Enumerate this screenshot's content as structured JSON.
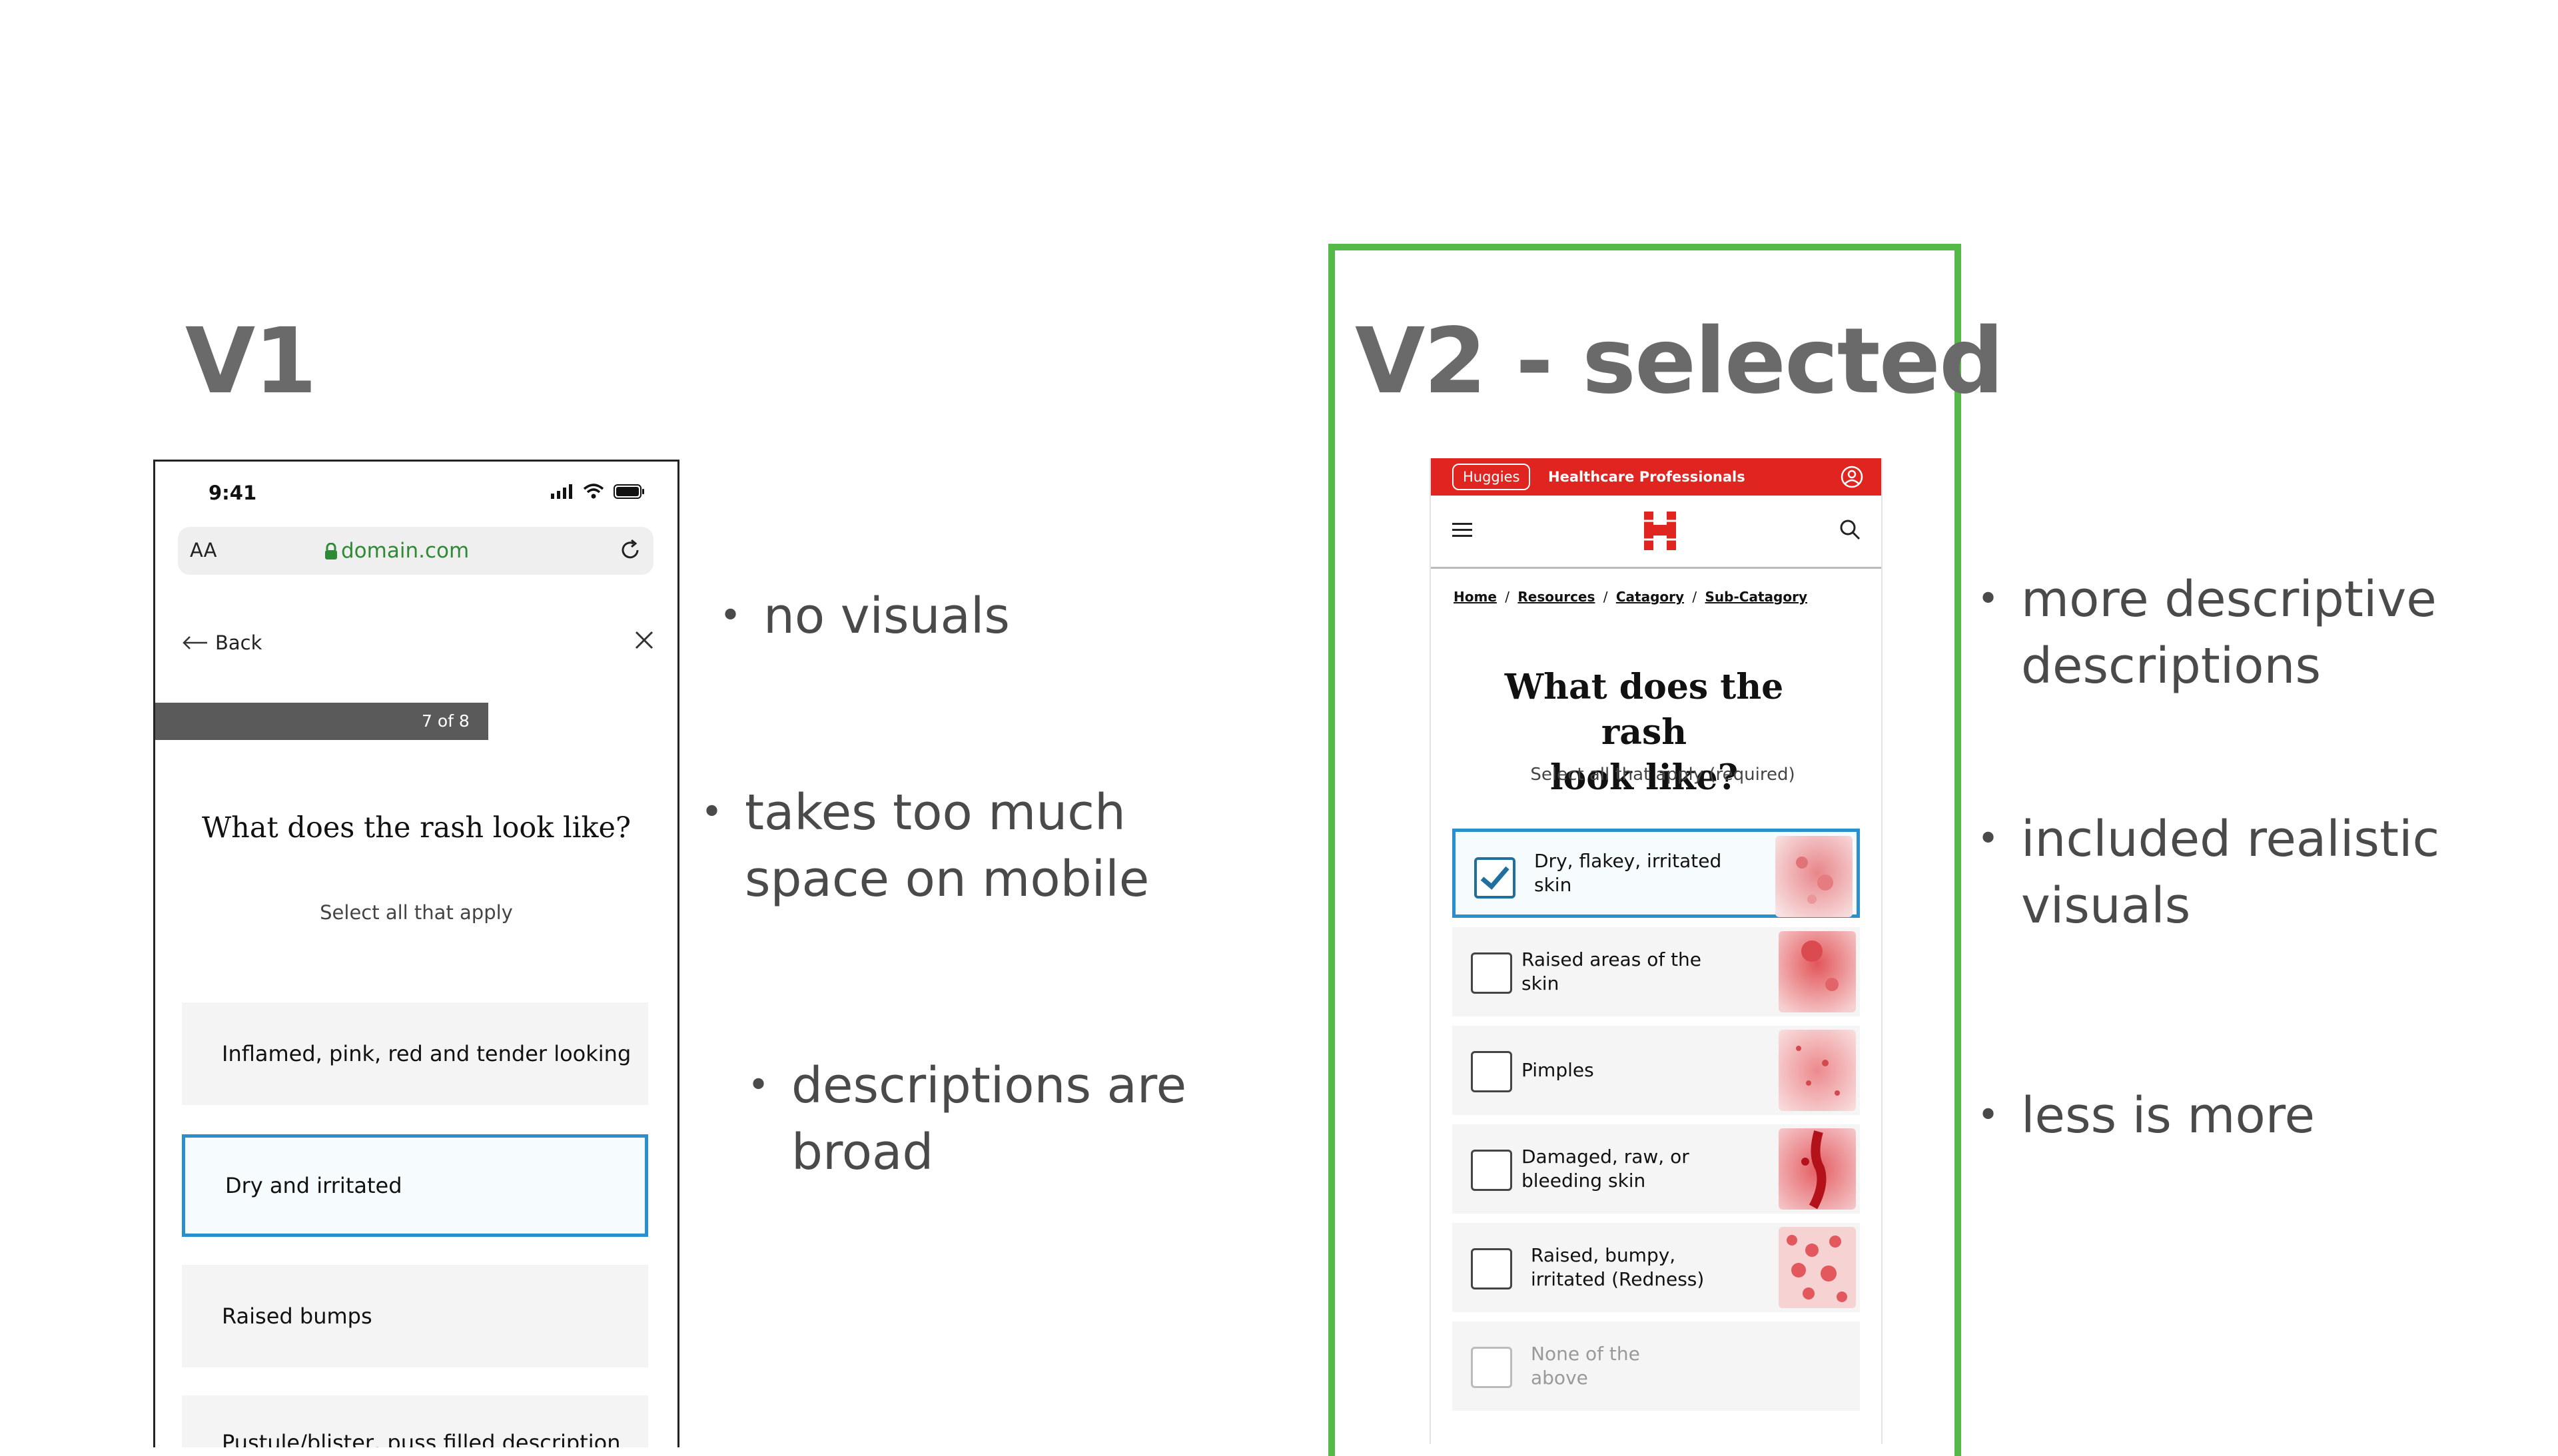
{
  "v1": {
    "heading": "V1",
    "phone": {
      "time": "9:41",
      "url_aa": "AA",
      "url_domain": "domain.com",
      "back_label": "Back",
      "progress_text": "7 of 8",
      "progress_fraction": 0.875,
      "question": "What does the rash look like?",
      "subtitle": "Select all that apply",
      "options": [
        {
          "label": "Inflamed, pink, red and tender looking",
          "selected": false
        },
        {
          "label": "Dry and irritated",
          "selected": true
        },
        {
          "label": "Raised bumps",
          "selected": false
        },
        {
          "label": "Pustule/blister, puss filled description",
          "selected": false
        }
      ]
    },
    "notes": [
      "no visuals",
      "takes too much",
      "space on mobile",
      "descriptions are",
      "broad"
    ]
  },
  "v2": {
    "heading": "V2 - selected",
    "highlight_color": "#55b947",
    "phone": {
      "brand_pill": "Huggies",
      "top_link": "Healthcare Professionals",
      "brand_color": "#e0241f",
      "breadcrumbs": [
        "Home",
        "Resources",
        "Catagory",
        "Sub-Catagory"
      ],
      "question_line1": "What does the rash",
      "question_line2": "look like?",
      "subtitle": "Select all that apply (required)",
      "options": [
        {
          "label": "Dry, flakey, irritated skin",
          "selected": true,
          "dimmed": false
        },
        {
          "label": "Raised areas of the skin",
          "selected": false,
          "dimmed": false
        },
        {
          "label": "Pimples",
          "selected": false,
          "dimmed": false
        },
        {
          "label": "Damaged, raw, or bleeding skin",
          "selected": false,
          "dimmed": false
        },
        {
          "label": "Raised, bumpy, irritated (Redness)",
          "selected": false,
          "dimmed": false
        },
        {
          "label": "None of the above",
          "selected": false,
          "dimmed": true
        }
      ]
    },
    "notes": [
      "more descriptive",
      "descriptions",
      "included realistic",
      "visuals",
      "less is more"
    ]
  },
  "bullet": "•",
  "breadcrumb_sep": "/"
}
